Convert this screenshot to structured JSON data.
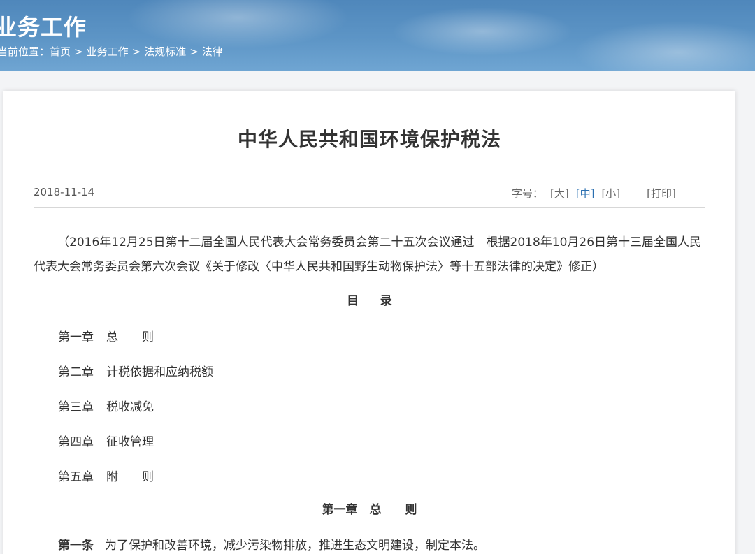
{
  "banner": {
    "title": "业务工作",
    "breadcrumb": {
      "prefix": "当前位置：",
      "items": [
        "首页",
        "业务工作",
        "法规标准",
        "法律"
      ],
      "separator": ">"
    }
  },
  "article": {
    "title": "中华人民共和国环境保护税法",
    "date": "2018-11-14",
    "font_size_label": "字号：",
    "font_sizes": [
      "[大]",
      "[中]",
      "[小]"
    ],
    "active_font_size": "[中]",
    "print_label": "[打印]",
    "preamble": "（2016年12月25日第十二届全国人民代表大会常务委员会第二十五次会议通过　根据2018年10月26日第十三届全国人民代表大会常务委员会第六次会议《关于修改〈中华人民共和国野生动物保护法〉等十五部法律的决定》修正）",
    "toc_heading": "目录",
    "toc": [
      {
        "num": "第一章",
        "name": "总　　则"
      },
      {
        "num": "第二章",
        "name": "计税依据和应纳税额"
      },
      {
        "num": "第三章",
        "name": "税收减免"
      },
      {
        "num": "第四章",
        "name": "征收管理"
      },
      {
        "num": "第五章",
        "name": "附　　则"
      }
    ],
    "chapter1_heading": "第一章　总　　则",
    "article1": {
      "num": "第一条",
      "text": "为了保护和改善环境，减少污染物排放，推进生态文明建设，制定本法。"
    }
  },
  "colors": {
    "banner": "#5d95c6",
    "accent": "#2a6fb0",
    "text": "#333333"
  }
}
